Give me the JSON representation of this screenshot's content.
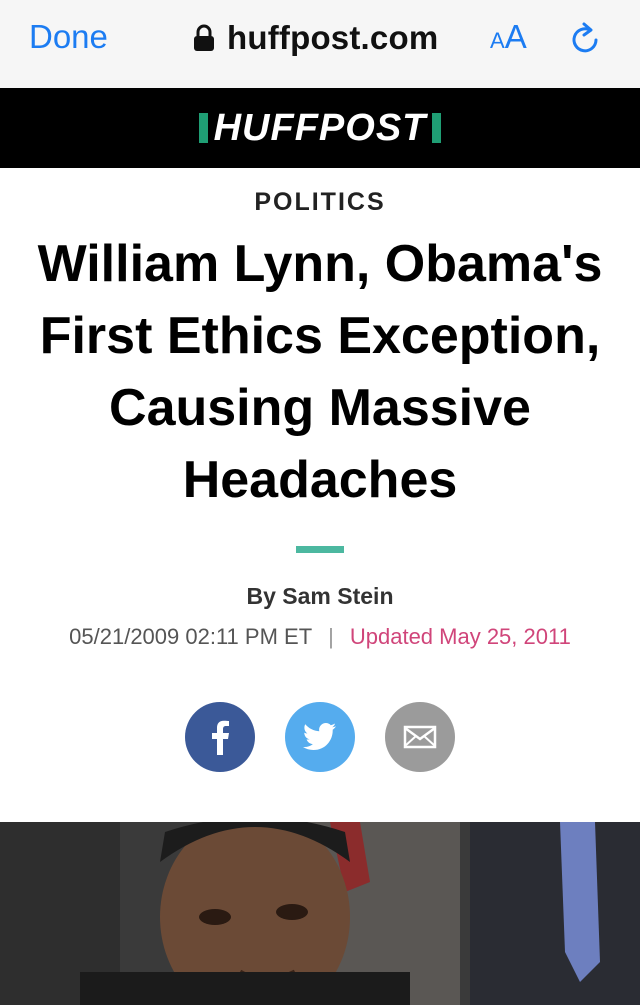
{
  "browser": {
    "done_label": "Done",
    "url": "huffpost.com",
    "text_size_label_small": "A",
    "text_size_label_large": "A",
    "lock_icon": "lock-icon",
    "reload_icon": "reload-icon"
  },
  "header": {
    "brand": "HUFFPOST",
    "brand_accent": "#1f9e74"
  },
  "article": {
    "section": "POLITICS",
    "headline": "William Lynn, Obama's First Ethics Exception, Causing Massive Headaches",
    "byline": "By Sam Stein",
    "published": "05/21/2009 02:11 PM ET",
    "separator": "|",
    "updated": "Updated May 25, 2011"
  },
  "share": {
    "facebook_icon": "facebook-icon",
    "twitter_icon": "twitter-icon",
    "email_icon": "email-icon"
  },
  "colors": {
    "link_blue": "#1c7cf2",
    "updated_pink": "#d0457a",
    "rule_teal": "#4cb8a0"
  }
}
